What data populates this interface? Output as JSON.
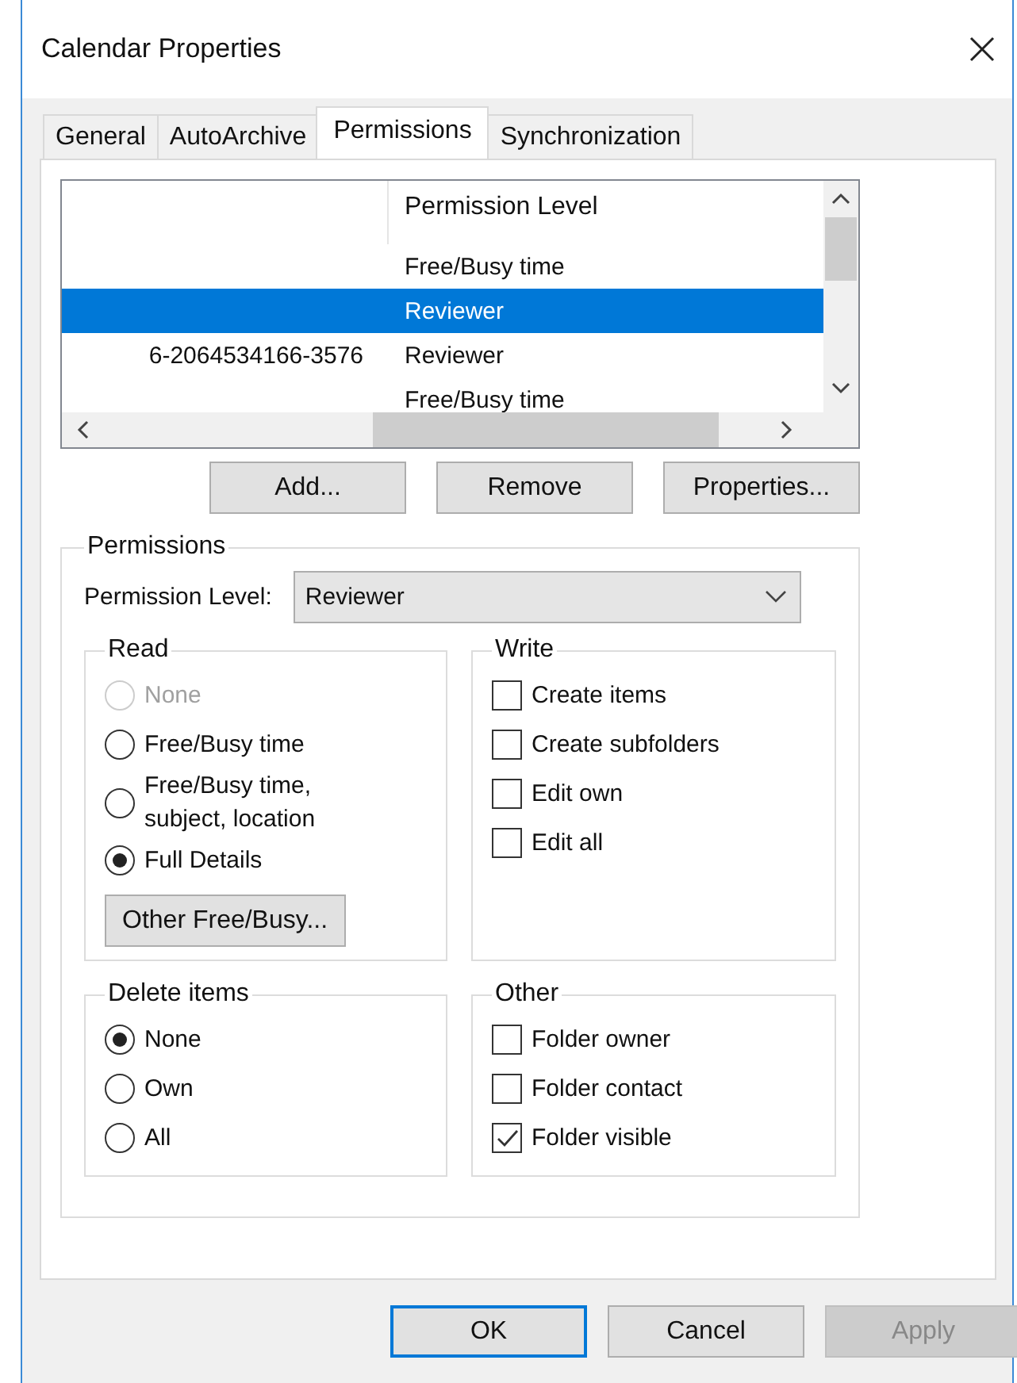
{
  "window": {
    "title": "Calendar Properties"
  },
  "tabs": [
    {
      "label": "General",
      "selected": false
    },
    {
      "label": "AutoArchive",
      "selected": false
    },
    {
      "label": "Permissions",
      "selected": true
    },
    {
      "label": "Synchronization",
      "selected": false
    }
  ],
  "permissions_list": {
    "column_2_header": "Permission Level",
    "rows": [
      {
        "permission_level": "Free/Busy time",
        "selected": false
      },
      {
        "permission_level": "Reviewer",
        "selected": true
      },
      {
        "name": "6-2064534166-3576",
        "permission_level": "Reviewer",
        "selected": false
      },
      {
        "permission_level": "Free/Busy time",
        "selected": false
      }
    ]
  },
  "list_buttons": [
    "Add...",
    "Remove",
    "Properties..."
  ],
  "permissions": {
    "title": "Permissions",
    "permission_level_label": "Permission Level:",
    "permission_level_value": "Reviewer",
    "read": {
      "title": "Read",
      "options": [
        {
          "label": "None",
          "selected": false,
          "disabled": true
        },
        {
          "label": "Free/Busy time",
          "selected": false,
          "disabled": false
        },
        {
          "label": "Free/Busy time, subject, location",
          "selected": false,
          "disabled": false
        },
        {
          "label": "Full Details",
          "selected": true,
          "disabled": false
        }
      ],
      "button": "Other Free/Busy..."
    },
    "write": {
      "title": "Write",
      "items": [
        {
          "label": "Create items",
          "checked": false
        },
        {
          "label": "Create subfolders",
          "checked": false
        },
        {
          "label": "Edit own",
          "checked": false
        },
        {
          "label": "Edit all",
          "checked": false
        }
      ]
    },
    "delete_items": {
      "title": "Delete items",
      "options": [
        {
          "label": "None",
          "selected": true,
          "disabled": false
        },
        {
          "label": "Own",
          "selected": false,
          "disabled": false
        },
        {
          "label": "All",
          "selected": false,
          "disabled": false
        }
      ]
    },
    "other": {
      "title": "Other",
      "items": [
        {
          "label": "Folder owner",
          "checked": false
        },
        {
          "label": "Folder contact",
          "checked": false
        },
        {
          "label": "Folder visible",
          "checked": true
        }
      ]
    }
  },
  "dialog_buttons": [
    {
      "label": "OK",
      "default": true,
      "disabled": false
    },
    {
      "label": "Cancel",
      "default": false,
      "disabled": false
    },
    {
      "label": "Apply",
      "default": false,
      "disabled": true
    }
  ]
}
